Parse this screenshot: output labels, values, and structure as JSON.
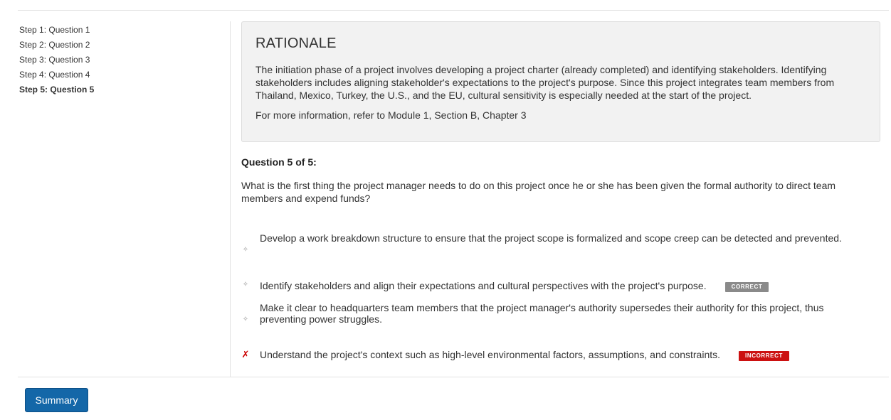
{
  "sidebar": {
    "steps": [
      {
        "label": "Step 1: Question 1",
        "active": false
      },
      {
        "label": "Step 2: Question 2",
        "active": false
      },
      {
        "label": "Step 3: Question 3",
        "active": false
      },
      {
        "label": "Step 4: Question 4",
        "active": false
      },
      {
        "label": "Step 5: Question 5",
        "active": true
      }
    ]
  },
  "rationale": {
    "title": "RATIONALE",
    "body": "The initiation phase of a project involves developing a project charter (already completed) and identifying stakeholders. Identifying stakeholders includes aligning stakeholder's expectations to the project's purpose. Since this project integrates team members from Thailand, Mexico, Turkey, the U.S., and the EU, cultural sensitivity is especially needed at the start of the project.",
    "reference": "For more information, refer to Module 1, Section B, Chapter 3"
  },
  "question": {
    "heading": "Question 5 of 5:",
    "text": "What is the first thing the project manager needs to do on this project once he or she has been given the formal authority to direct team members and expend funds?",
    "answers": [
      {
        "text": "Develop a work breakdown structure to ensure that the project scope is formalized and scope creep can be detected and prevented.",
        "marker": "diamond-icon",
        "badge": ""
      },
      {
        "text": "Identify stakeholders and align their expectations and cultural perspectives with the project's purpose.",
        "marker": "diamond-icon",
        "badge": "CORRECT"
      },
      {
        "text": "Make it clear to headquarters team members that the project manager's authority supersedes their authority for this project, thus preventing power struggles.",
        "marker": "diamond-icon",
        "badge": ""
      },
      {
        "text": "Understand the project's context such as high-level environmental factors, assumptions, and constraints.",
        "marker": "x-icon",
        "badge": "INCORRECT"
      }
    ]
  },
  "footer": {
    "summary_label": "Summary"
  },
  "colors": {
    "primary_button": "#1467a8",
    "correct_badge": "#8a8a8a",
    "incorrect_badge": "#cc1111",
    "incorrect_mark": "#cc0000",
    "rationale_bg": "#f2f2f2"
  },
  "glyphs": {
    "diamond": "✧",
    "cross": "✗"
  }
}
